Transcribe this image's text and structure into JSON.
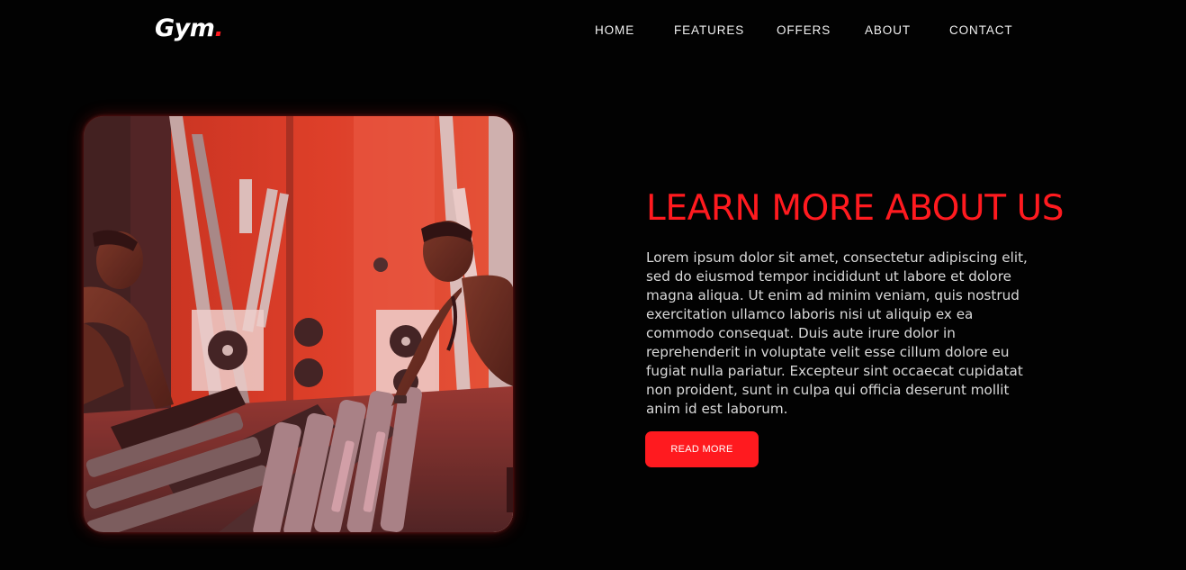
{
  "brand": {
    "logo_text": "Gym",
    "logo_dot": ".",
    "accent_color": "#ff1a1f"
  },
  "nav": {
    "items": [
      {
        "label": "HOME"
      },
      {
        "label": "FEATURES"
      },
      {
        "label": "OFFERS"
      },
      {
        "label": "ABOUT"
      },
      {
        "label": "CONTACT"
      }
    ]
  },
  "about": {
    "image_subject": "gym-photo",
    "heading": "LEARN MORE ABOUT US",
    "body": "Lorem ipsum dolor sit amet, consectetur adipiscing elit, sed do eiusmod tempor incididunt ut labore et dolore magna aliqua. Ut enim ad minim veniam, quis nostrud exercitation ullamco laboris nisi ut aliquip ex ea commodo consequat. Duis aute irure dolor in reprehenderit in voluptate velit esse cillum dolore eu fugiat nulla pariatur. Excepteur sint occaecat cupidatat non proident, sunt in culpa qui officia deserunt mollit anim id est laborum.",
    "button_label": "READ MORE"
  }
}
